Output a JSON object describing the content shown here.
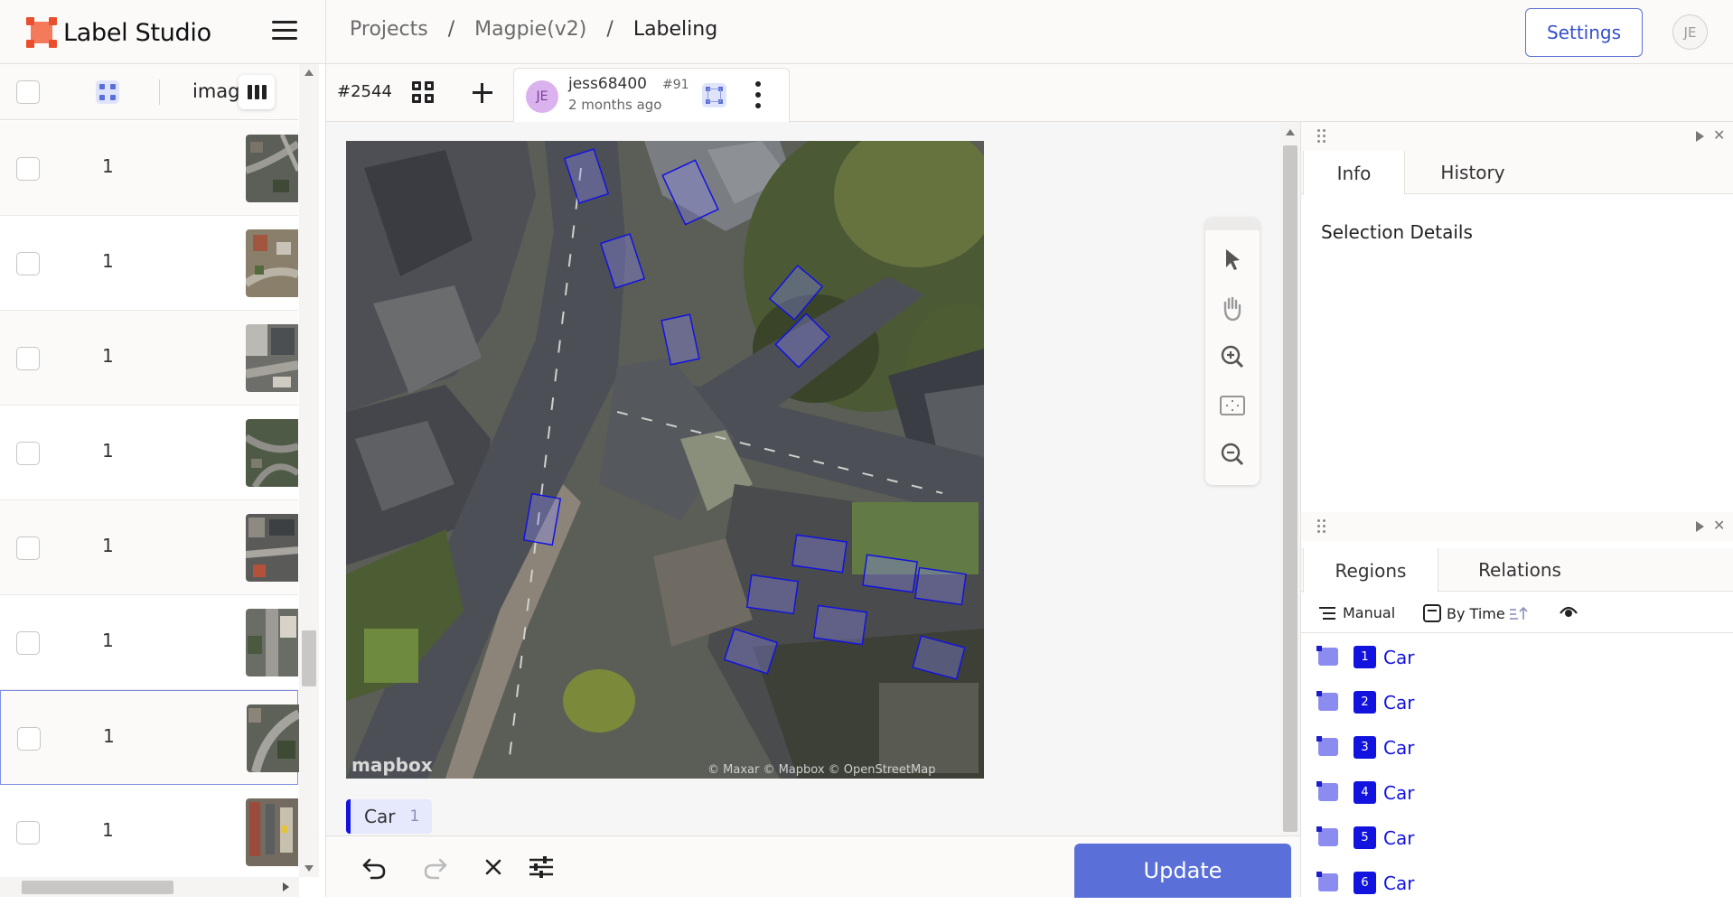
{
  "app": {
    "name": "Label Studio"
  },
  "breadcrumb": {
    "projects": "Projects",
    "project": "Magpie(v2)",
    "current": "Labeling",
    "sep": "/"
  },
  "header": {
    "settings_label": "Settings",
    "user_initials": "JE"
  },
  "task_list": {
    "column_image": "image",
    "rows": [
      {
        "count": "1"
      },
      {
        "count": "1"
      },
      {
        "count": "1"
      },
      {
        "count": "1"
      },
      {
        "count": "1"
      },
      {
        "count": "1"
      },
      {
        "count": "1",
        "selected": true
      },
      {
        "count": "1"
      }
    ]
  },
  "annotation": {
    "task_id": "#2544",
    "user": "jess68400",
    "annotation_number": "#91",
    "time_ago": "2 months ago",
    "user_initials": "JE"
  },
  "image": {
    "attribution_logo": "mapbox",
    "attribution_text": "© Maxar © Mapbox © OpenStreetMap"
  },
  "labels": [
    {
      "name": "Car",
      "hotkey": "1",
      "color": "#1313e0"
    }
  ],
  "controls": {
    "update_label": "Update"
  },
  "panels": {
    "top_tabs": [
      "Info",
      "History"
    ],
    "selection_details": "Selection Details",
    "bottom_tabs": [
      "Regions",
      "Relations"
    ],
    "order_mode": "Manual",
    "sort_by": "By Time"
  },
  "regions": [
    {
      "index": "1",
      "label": "Car"
    },
    {
      "index": "2",
      "label": "Car"
    },
    {
      "index": "3",
      "label": "Car"
    },
    {
      "index": "4",
      "label": "Car"
    },
    {
      "index": "5",
      "label": "Car"
    },
    {
      "index": "6",
      "label": "Car"
    }
  ],
  "colors": {
    "accent": "#5a6fd8",
    "region": "#1313e0",
    "brand": "#ea4f2d"
  },
  "icons": {
    "tools": [
      "pointer-icon",
      "hand-icon",
      "zoom-in-icon",
      "fit-icon",
      "zoom-out-icon"
    ],
    "bottom": [
      "undo-icon",
      "redo-icon",
      "reset-icon",
      "settings-sliders-icon"
    ]
  }
}
